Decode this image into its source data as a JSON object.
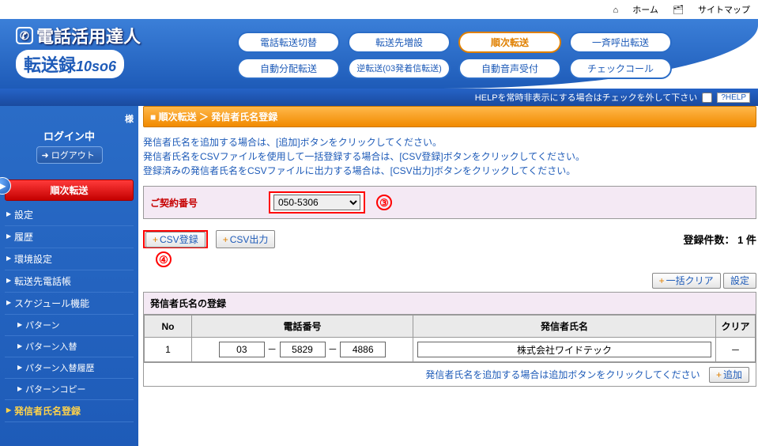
{
  "top_links": {
    "home": "ホーム",
    "sitemap": "サイトマップ"
  },
  "logo": {
    "title": "電話活用達人",
    "sub_main": "転送録",
    "sub_suffix": "10so6"
  },
  "nav": [
    {
      "label": "電話転送切替"
    },
    {
      "label": "転送先増設"
    },
    {
      "label": "順次転送"
    },
    {
      "label": "一斉呼出転送"
    },
    {
      "label": "自動分配転送"
    },
    {
      "label": "逆転送(03発着信転送)"
    },
    {
      "label": "自動音声受付"
    },
    {
      "label": "チェックコール"
    }
  ],
  "nav_active_index": 2,
  "help_bar": {
    "text": "HELPを常時非表示にする場合はチェックを外して下さい",
    "btn": "?HELP"
  },
  "sidebar": {
    "user_suffix": "様",
    "login_status": "ログイン中",
    "logout": "ログアウト",
    "menu_header": "順次転送",
    "items": [
      {
        "label": "設定"
      },
      {
        "label": "履歴"
      },
      {
        "label": "環境設定"
      },
      {
        "label": "転送先電話帳"
      },
      {
        "label": "スケジュール機能"
      },
      {
        "label": "パターン",
        "sub": true
      },
      {
        "label": "パターン入替",
        "sub": true
      },
      {
        "label": "パターン入替履歴",
        "sub": true
      },
      {
        "label": "パターンコピー",
        "sub": true
      },
      {
        "label": "発信者氏名登録",
        "hl": true
      }
    ]
  },
  "breadcrumb": "■ 順次転送 ＞ 発信者氏名登録",
  "instructions": {
    "l1": "発信者氏名を追加する場合は、[追加]ボタンをクリックしてください。",
    "l2": "発信者氏名をCSVファイルを使用して一括登録する場合は、[CSV登録]ボタンをクリックしてください。",
    "l3": "登録済みの発信者氏名をCSVファイルに出力する場合は、[CSV出力]ボタンをクリックしてください。"
  },
  "contract": {
    "label": "ご契約番号",
    "value": "050-5306",
    "annot": "③"
  },
  "csv": {
    "register": "CSV登録",
    "export": "CSV出力",
    "annot": "④"
  },
  "count": {
    "label": "登録件数：",
    "value": "1",
    "unit": "件"
  },
  "buttons": {
    "bulk_clear": "一括クリア",
    "settei": "設定",
    "add": "追加",
    "plus": "+"
  },
  "table": {
    "title": "発信者氏名の登録",
    "headers": {
      "no": "No",
      "phone": "電話番号",
      "name": "発信者氏名",
      "clear": "クリア"
    },
    "rows": [
      {
        "no": "1",
        "p1": "03",
        "p2": "5829",
        "p3": "4886",
        "name": "株式会社ワイドテック",
        "clear": "－"
      }
    ],
    "add_hint": "発信者氏名を追加する場合は追加ボタンをクリックしてください"
  }
}
